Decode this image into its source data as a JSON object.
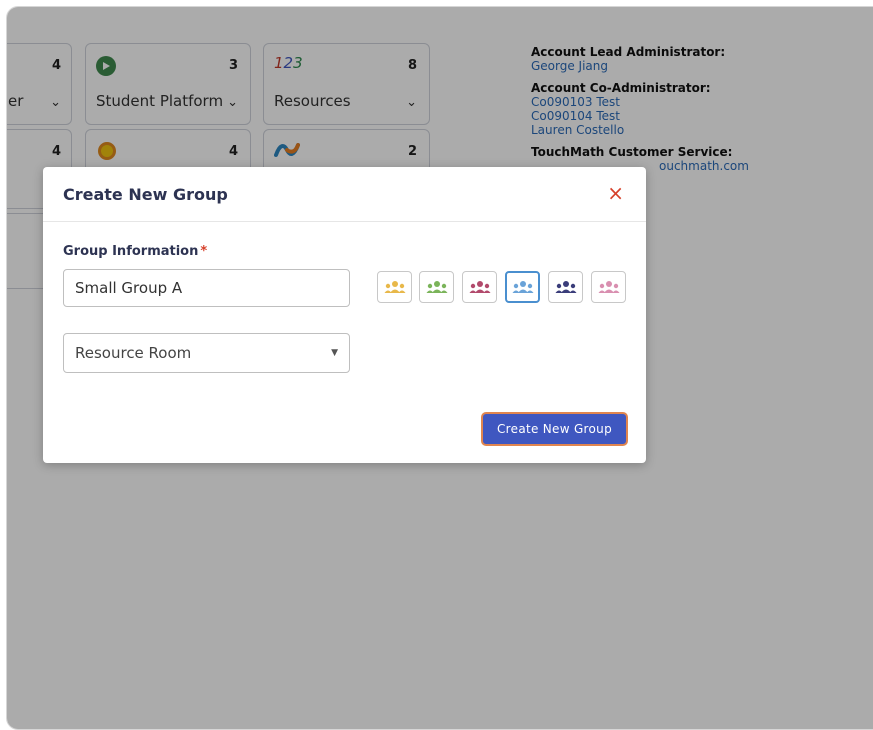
{
  "tiles_row1": [
    {
      "count": "4",
      "label": "er"
    },
    {
      "count": "3",
      "label": "Student Platform"
    },
    {
      "count": "8",
      "label": "Resources"
    }
  ],
  "tiles_row2": [
    {
      "count": "4"
    },
    {
      "count": "4"
    },
    {
      "count": "2"
    }
  ],
  "account": {
    "lead_heading": "Account Lead Administrator:",
    "lead_name": "George Jiang",
    "co_heading": "Account Co-Administrator:",
    "co_names": [
      "Co090103 Test",
      "Co090104 Test",
      "Lauren Costello"
    ],
    "service_heading": "TouchMath Customer Service:",
    "service_email": "ouchmath.com"
  },
  "modal": {
    "title": "Create New Group",
    "close_glyph": "×",
    "group_info_label": "Group Information",
    "required_mark": "*",
    "group_name_value": "Small Group A",
    "room_selected": "Resource Room",
    "submit_label": "Create New Group",
    "swatch_colors": [
      "#e8b84a",
      "#7bb45a",
      "#b24a6c",
      "#6aa3d8",
      "#3a3d7a",
      "#d98fb0"
    ],
    "selected_swatch": 3
  },
  "colors": {
    "accent": "#3f57c0",
    "danger": "#d6402a",
    "link": "#2b6ab8"
  }
}
